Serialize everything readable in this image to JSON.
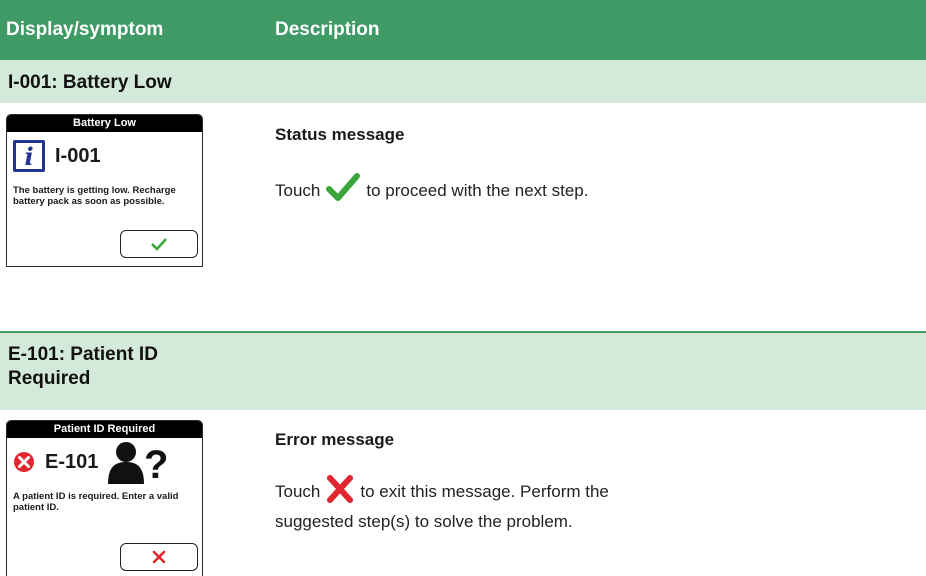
{
  "header": {
    "col1": "Display/symptom",
    "col2": "Description"
  },
  "rows": [
    {
      "section_title": "I-001: Battery Low",
      "device": {
        "title": "Battery Low",
        "icon": "info-icon",
        "code": "I-001",
        "message": "The battery is getting low. Recharge battery pack as soon as possible.",
        "button_icon": "checkmark-icon"
      },
      "heading": "Status message",
      "text_before": "Touch",
      "text_icon": "green-checkmark-icon",
      "text_after": "to proceed with the next step."
    },
    {
      "section_title": "E-101: Patient ID Required",
      "device": {
        "title": "Patient ID Required",
        "icon": "error-x-circle-icon",
        "code": "E-101",
        "extra_icon": "patient-question-icon",
        "message": "A patient ID is required. Enter a valid patient ID.",
        "button_icon": "cancel-x-icon"
      },
      "heading": "Error message",
      "text_before": "Touch",
      "text_icon": "red-x-icon",
      "text_after": "to exit this message. Perform the suggested step(s) to solve the problem."
    }
  ],
  "colors": {
    "header_bg": "#3f9a66",
    "section_bg": "#d3e9d9",
    "check_green": "#3aa63a",
    "error_red": "#e0262e",
    "info_blue": "#22368f"
  }
}
